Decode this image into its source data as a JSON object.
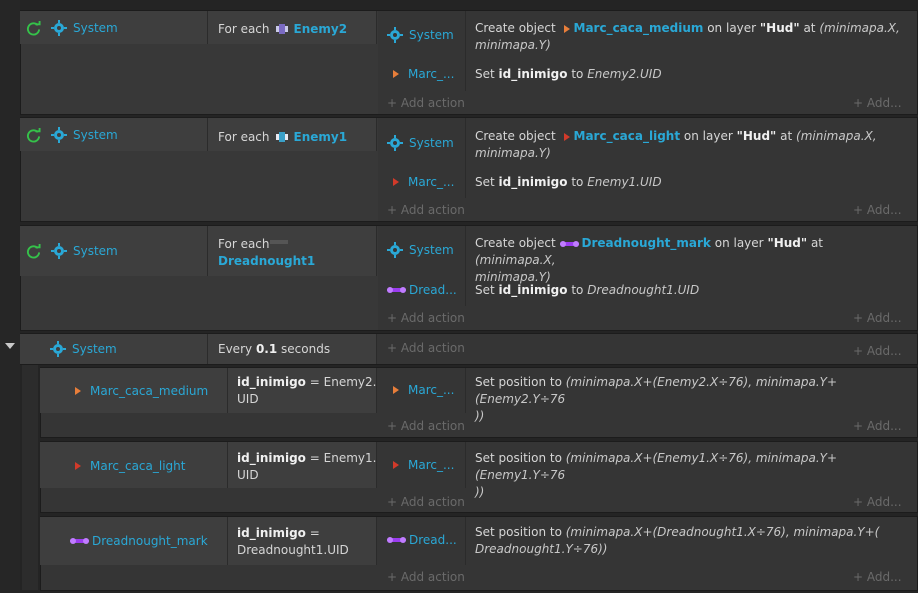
{
  "events": [
    {
      "condition": {
        "object": "System",
        "text": "For each",
        "target": "Enemy2"
      },
      "actions": [
        {
          "object": "System",
          "create_prefix": "Create object",
          "create_obj": "Marc_caca_medium",
          "layer_word": "on layer",
          "layer": "\"Hud\"",
          "at": "at",
          "pos1": "(minimapa.X,",
          "pos2": "minimapa.Y)"
        },
        {
          "object": "Marc_...",
          "set_prefix": "Set",
          "var": "id_inimigo",
          "to": "to",
          "val": "Enemy2.UID"
        }
      ]
    },
    {
      "condition": {
        "object": "System",
        "text": "For each",
        "target": "Enemy1"
      },
      "actions": [
        {
          "object": "System",
          "create_prefix": "Create object",
          "create_obj": "Marc_caca_light",
          "layer_word": "on layer",
          "layer": "\"Hud\"",
          "at": "at",
          "pos1": "(minimapa.X,",
          "pos2": "minimapa.Y)"
        },
        {
          "object": "Marc_...",
          "set_prefix": "Set",
          "var": "id_inimigo",
          "to": "to",
          "val": "Enemy1.UID"
        }
      ]
    },
    {
      "condition": {
        "object": "System",
        "text": "For each",
        "target": "Dreadnought1"
      },
      "actions": [
        {
          "object": "System",
          "create_prefix": "Create object",
          "create_obj": "Dreadnought_mark",
          "layer_word": "on layer",
          "layer": "\"Hud\"",
          "at": "at",
          "pos1": "(minimapa.X,",
          "pos2": "minimapa.Y)"
        },
        {
          "object": "Dread...",
          "set_prefix": "Set",
          "var": "id_inimigo",
          "to": "to",
          "val": "Dreadnought1.UID"
        }
      ]
    },
    {
      "condition": {
        "object": "System",
        "every": "Every",
        "interval": "0.1",
        "unit": "seconds"
      }
    }
  ],
  "subevents": [
    {
      "object": "Marc_caca_medium",
      "cond_var": "id_inimigo",
      "cond_eq": "= Enemy2.",
      "cond_eq2": "UID",
      "act_obj": "Marc_...",
      "act1": "Set position to",
      "act2": "(minimapa.X+(Enemy2.X÷76), minimapa.Y+(Enemy2.Y÷76",
      "act3": "))"
    },
    {
      "object": "Marc_caca_light",
      "cond_var": "id_inimigo",
      "cond_eq": "= Enemy1.",
      "cond_eq2": "UID",
      "act_obj": "Marc_...",
      "act1": "Set position to",
      "act2": "(minimapa.X+(Enemy1.X÷76), minimapa.Y+(Enemy1.Y÷76",
      "act3": "))"
    },
    {
      "object": "Dreadnought_mark",
      "cond_var": "id_inimigo",
      "cond_eq": "=",
      "cond_eq2": "Dreadnought1.UID",
      "act_obj": "Dread...",
      "act1": "Set position to",
      "act2": "(minimapa.X+(Dreadnought1.X÷76), minimapa.Y+(",
      "act3": "Dreadnought1.Y÷76))"
    }
  ],
  "labels": {
    "add_action": "+ Add action",
    "add_more": "+ Add..."
  },
  "colors": {
    "accent": "#2aa8d6",
    "loop": "#35c24a",
    "orange_tri": "#e87e3a",
    "red_tri": "#d23a2a",
    "purple": "#9b3cf0"
  }
}
